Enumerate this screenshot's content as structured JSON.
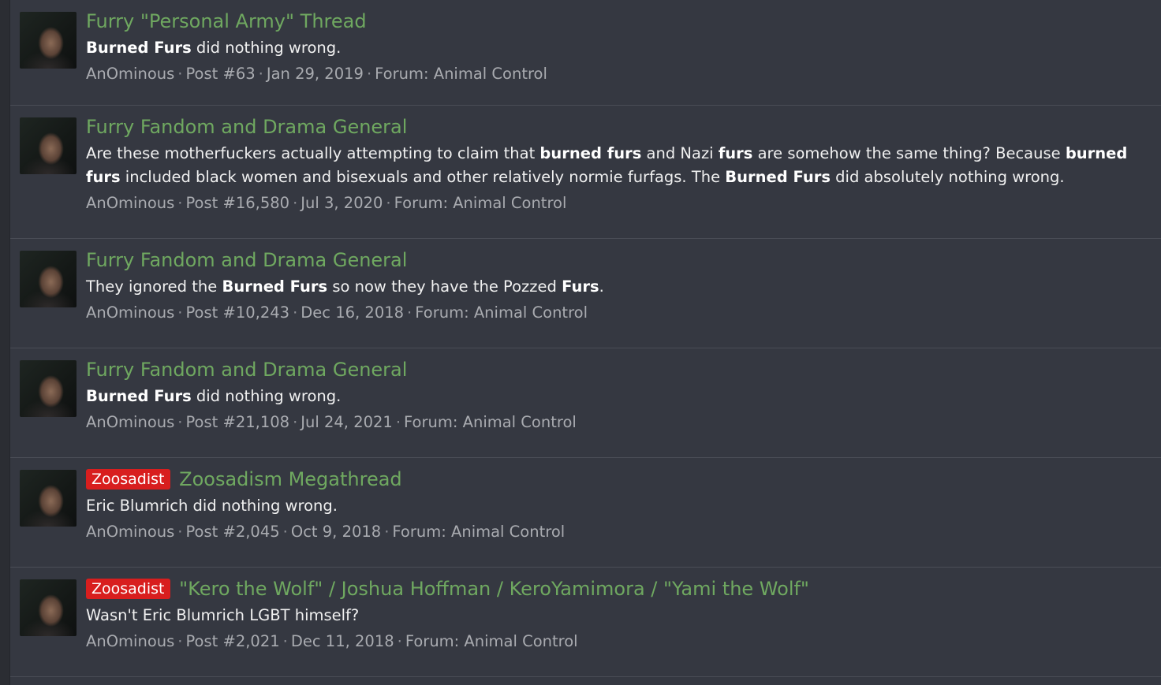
{
  "results": [
    {
      "label": "",
      "title": "Furry \"Personal Army\" Thread",
      "snippet_html": "<b>Burned Furs</b> did nothing wrong.",
      "author": "AnOminous",
      "post": "Post #63",
      "date": "Jan 29, 2019",
      "forum": "Forum: Animal Control"
    },
    {
      "label": "",
      "title": "Furry Fandom and Drama General",
      "snippet_html": "Are these motherfuckers actually attempting to claim that <b>burned furs</b> and Nazi <b>furs</b> are somehow the same thing? Because <b>burned furs</b> included black women and bisexuals and other relatively normie furfags. The <b>Burned Furs</b> did absolutely nothing wrong.",
      "author": "AnOminous",
      "post": "Post #16,580",
      "date": "Jul 3, 2020",
      "forum": "Forum: Animal Control"
    },
    {
      "label": "",
      "title": "Furry Fandom and Drama General",
      "snippet_html": "They ignored the <b>Burned Furs</b> so now they have the Pozzed <b>Furs</b>.",
      "author": "AnOminous",
      "post": "Post #10,243",
      "date": "Dec 16, 2018",
      "forum": "Forum: Animal Control"
    },
    {
      "label": "",
      "title": "Furry Fandom and Drama General",
      "snippet_html": "<b>Burned Furs</b> did nothing wrong.",
      "author": "AnOminous",
      "post": "Post #21,108",
      "date": "Jul 24, 2021",
      "forum": "Forum: Animal Control"
    },
    {
      "label": "Zoosadist",
      "title": "Zoosadism Megathread",
      "snippet_html": "Eric Blumrich did nothing wrong.",
      "author": "AnOminous",
      "post": "Post #2,045",
      "date": "Oct 9, 2018",
      "forum": "Forum: Animal Control"
    },
    {
      "label": "Zoosadist",
      "title": "\"Kero the Wolf\" / Joshua Hoffman / KeroYamimora / \"Yami the Wolf\"",
      "snippet_html": "Wasn't Eric Blumrich LGBT himself?",
      "author": "AnOminous",
      "post": "Post #2,021",
      "date": "Dec 11, 2018",
      "forum": "Forum: Animal Control"
    }
  ],
  "colors": {
    "background": "#353841",
    "title_link": "#6fa860",
    "label_red": "#d81e1e",
    "meta_text": "#a9abb0"
  }
}
